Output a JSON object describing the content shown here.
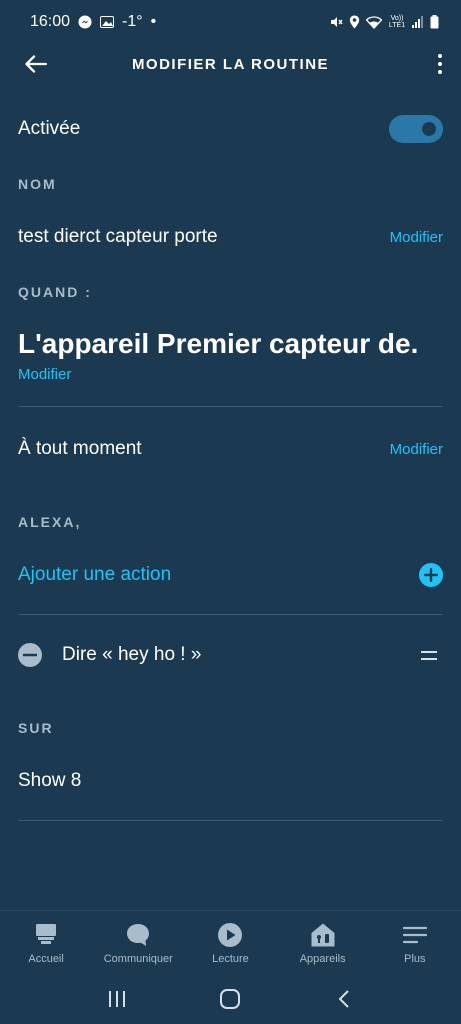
{
  "status": {
    "time": "16:00",
    "temp": "-1°",
    "dot": "•",
    "network_label": "Vo)) LTE1"
  },
  "header": {
    "title": "MODIFIER LA ROUTINE"
  },
  "enabled": {
    "label": "Activée",
    "value": true
  },
  "name_section": {
    "label": "NOM",
    "value": "test dierct capteur porte",
    "edit": "Modifier"
  },
  "when_section": {
    "label": "QUAND :",
    "trigger": "L'appareil Premier capteur de.",
    "trigger_edit": "Modifier",
    "schedule": "À tout moment",
    "schedule_edit": "Modifier"
  },
  "actions_section": {
    "label": "ALEXA,",
    "add_action": "Ajouter une action",
    "items": [
      {
        "label": "Dire « hey ho ! »"
      }
    ]
  },
  "on_section": {
    "label": "SUR",
    "device": "Show 8"
  },
  "bottom_nav": [
    {
      "label": "Accueil",
      "icon": "home-icon"
    },
    {
      "label": "Communiquer",
      "icon": "chat-bubble-icon"
    },
    {
      "label": "Lecture",
      "icon": "play-icon"
    },
    {
      "label": "Appareils",
      "icon": "devices-house-icon"
    },
    {
      "label": "Plus",
      "icon": "menu-lines-icon"
    }
  ],
  "colors": {
    "background": "#1b3a52",
    "accent": "#1ec4f4",
    "muted": "#a8bccb"
  }
}
